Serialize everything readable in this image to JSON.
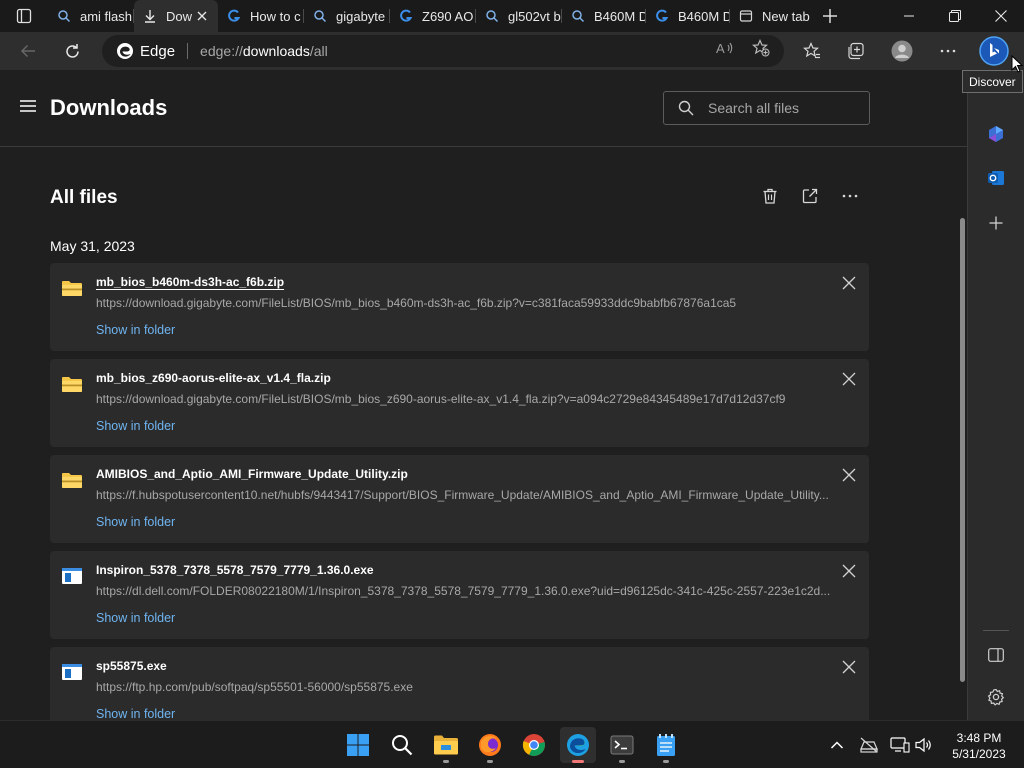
{
  "tabs": [
    {
      "title": "ami flash",
      "icon": "search-icon"
    },
    {
      "title": "Dow",
      "icon": "download-icon",
      "active": true
    },
    {
      "title": "How to c",
      "icon": "gigabyte-logo-icon"
    },
    {
      "title": "gigabyte",
      "icon": "search-icon"
    },
    {
      "title": "Z690 AO",
      "icon": "gigabyte-logo-icon"
    },
    {
      "title": "gl502vt b",
      "icon": "search-icon"
    },
    {
      "title": "B460M D",
      "icon": "search-icon"
    },
    {
      "title": "B460M D",
      "icon": "gigabyte-logo-icon"
    },
    {
      "title": "New tab",
      "icon": "new-tab-page-icon"
    }
  ],
  "address_bar": {
    "site_label": "Edge",
    "url_scheme": "edge://",
    "url_host": "downloads",
    "url_path": "/all"
  },
  "tooltip": "Discover",
  "page": {
    "title": "Downloads",
    "search_placeholder": "Search all files",
    "section_title": "All files",
    "date_heading": "May 31, 2023"
  },
  "downloads": [
    {
      "name": "mb_bios_b460m-ds3h-ac_f6b.zip",
      "url": "https://download.gigabyte.com/FileList/BIOS/mb_bios_b460m-ds3h-ac_f6b.zip?v=c381faca59933ddc9babfb67876a1ca5",
      "action": "Show in folder",
      "type": "zip"
    },
    {
      "name": "mb_bios_z690-aorus-elite-ax_v1.4_fla.zip",
      "url": "https://download.gigabyte.com/FileList/BIOS/mb_bios_z690-aorus-elite-ax_v1.4_fla.zip?v=a094c2729e84345489e17d7d12d37cf9",
      "action": "Show in folder",
      "type": "zip"
    },
    {
      "name": "AMIBIOS_and_Aptio_AMI_Firmware_Update_Utility.zip",
      "url": "https://f.hubspotusercontent10.net/hubfs/9443417/Support/BIOS_Firmware_Update/AMIBIOS_and_Aptio_AMI_Firmware_Update_Utility...",
      "action": "Show in folder",
      "type": "zip"
    },
    {
      "name": "Inspiron_5378_7378_5578_7579_7779_1.36.0.exe",
      "url": "https://dl.dell.com/FOLDER08022180M/1/Inspiron_5378_7378_5578_7579_7779_1.36.0.exe?uid=d96125dc-341c-425c-2557-223e1c2d...",
      "action": "Show in folder",
      "type": "exe"
    },
    {
      "name": "sp55875.exe",
      "url": "https://ftp.hp.com/pub/softpaq/sp55501-56000/sp55875.exe",
      "action": "Show in folder",
      "type": "exe"
    }
  ],
  "clock": {
    "time": "3:48 PM",
    "date": "5/31/2023"
  },
  "colors": {
    "accent_link": "#6fb4f0",
    "card_bg": "#2b2b2b",
    "page_bg": "#1f1f1f"
  }
}
